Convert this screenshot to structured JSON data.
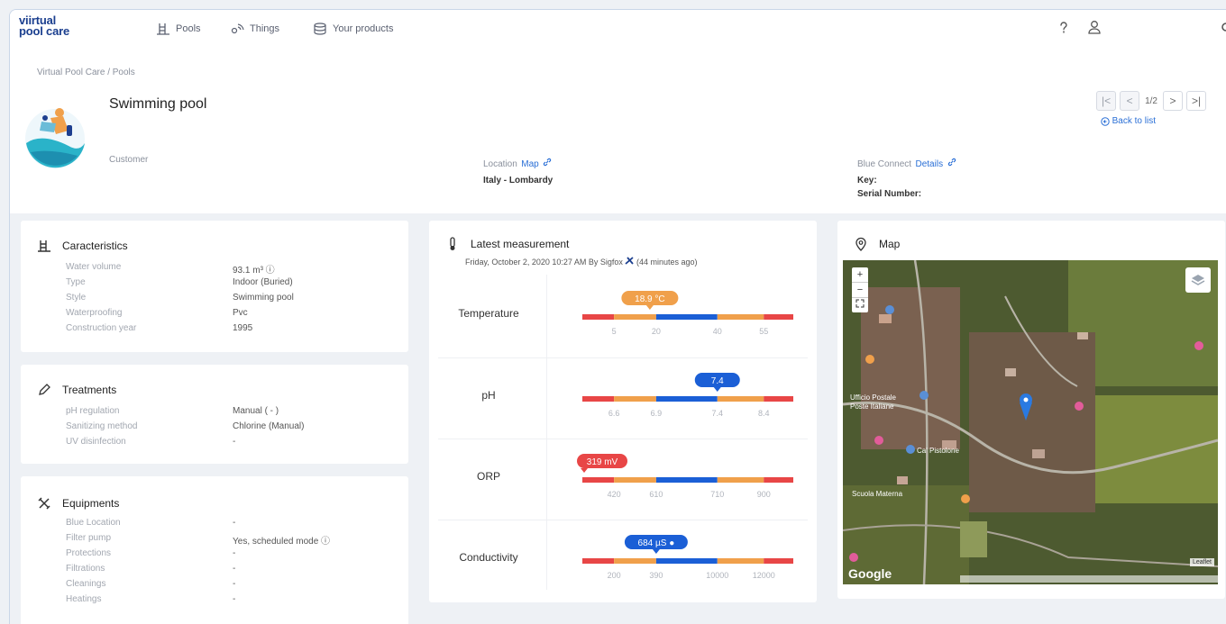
{
  "brand": {
    "line1": "viirtual",
    "line2": "pool care"
  },
  "nav": {
    "pools": "Pools",
    "things": "Things",
    "products": "Your products"
  },
  "breadcrumb": "Virtual Pool Care  /  Pools",
  "pool": {
    "title": "Swimming pool",
    "customer_label": "Customer",
    "location_label": "Location",
    "location_link": "Map",
    "location_value": "Italy - Lombardy",
    "connect_label": "Blue Connect",
    "connect_link": "Details",
    "key_label": "Key:",
    "serial_label": "Serial Number:"
  },
  "pager": {
    "prev_first": "|<",
    "prev": "<",
    "page": "1/2",
    "next": ">",
    "next_last": ">|",
    "back": "Back to list"
  },
  "characteristics": {
    "title": "Caracteristics",
    "rows": [
      {
        "k": "Water volume",
        "v": "93.1 m³ ⓘ"
      },
      {
        "k": "Type",
        "v": "Indoor (Buried)"
      },
      {
        "k": "Style",
        "v": "Swimming pool"
      },
      {
        "k": "Waterproofing",
        "v": "Pvc"
      },
      {
        "k": "Construction year",
        "v": "1995"
      }
    ]
  },
  "treatments": {
    "title": "Treatments",
    "rows": [
      {
        "k": "pH regulation",
        "v": "Manual ( - )"
      },
      {
        "k": "Sanitizing method",
        "v": "Chlorine (Manual)"
      },
      {
        "k": "UV disinfection",
        "v": "-"
      }
    ]
  },
  "equipments": {
    "title": "Equipments",
    "rows": [
      {
        "k": "Blue Location",
        "v": "-"
      },
      {
        "k": "Filter pump",
        "v": "Yes, scheduled mode ⓘ"
      },
      {
        "k": "Protections",
        "v": "-"
      },
      {
        "k": "Filtrations",
        "v": "-"
      },
      {
        "k": "Cleanings",
        "v": "-"
      },
      {
        "k": "Heatings",
        "v": "-"
      }
    ]
  },
  "measurement": {
    "title": "Latest measurement",
    "subtitle": "Friday, October 2, 2020 10:27 AM By Sigfox",
    "ago": "(44 minutes ago)",
    "items": [
      {
        "name": "Temperature",
        "value": "18.9 °C",
        "ticks": [
          "5",
          "20",
          "40",
          "55"
        ],
        "pos": 0.32,
        "color": "#f0a04b"
      },
      {
        "name": "pH",
        "value": "7.4",
        "ticks": [
          "6.6",
          "6.9",
          "7.4",
          "8.4"
        ],
        "pos": 0.64,
        "color": "#1b5fd6"
      },
      {
        "name": "ORP",
        "value": "319 mV",
        "ticks": [
          "420",
          "610",
          "710",
          "900"
        ],
        "pos": 0.0,
        "color": "#e84646"
      },
      {
        "name": "Conductivity",
        "value": "684 µS ●",
        "ticks": [
          "200",
          "390",
          "10000",
          "12000"
        ],
        "pos": 0.35,
        "color": "#1b5fd6"
      }
    ]
  },
  "map": {
    "title": "Map",
    "zoom_in": "+",
    "zoom_out": "−",
    "attribution": "Leaflet",
    "google": "Google",
    "places": [
      "Ufficio Postale",
      "Poste Italiane",
      "Ca' Pistolone",
      "Scuola Materna"
    ]
  },
  "colors": {
    "red": "#e84646",
    "orange": "#f0a04b",
    "blue": "#1b5fd6",
    "link": "#2a6fd6"
  }
}
